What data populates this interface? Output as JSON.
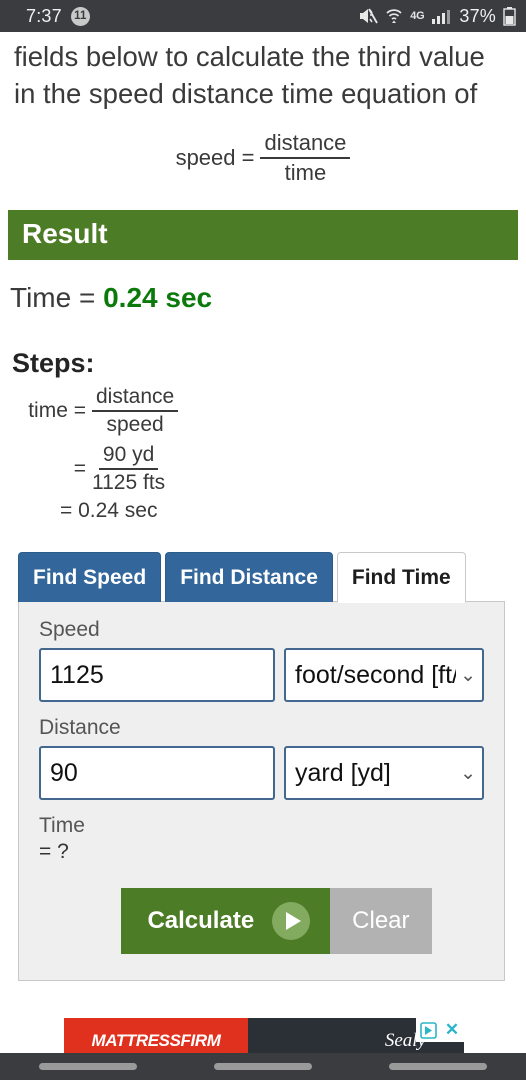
{
  "statusbar": {
    "time": "7:37",
    "notification_count": "11",
    "mute_icon": "mute-icon",
    "wifi_icon": "wifi-icon",
    "network_label": "4G",
    "signal_icon": "signal-bars-icon",
    "battery_percent": "37%",
    "battery_icon": "battery-icon"
  },
  "article": {
    "paragraph": "fields below to calculate the third value in the speed distance time equation of",
    "formula": {
      "lhs": "speed =",
      "numerator": "distance",
      "denominator": "time"
    }
  },
  "result": {
    "heading": "Result",
    "label": "Time = ",
    "value": "0.24 sec",
    "value_color": "#0b7a0b",
    "banner_color": "#4d7c26"
  },
  "steps": {
    "title": "Steps:",
    "line1": {
      "lead": "time =",
      "numerator": "distance",
      "denominator": "speed"
    },
    "line2": {
      "lead": "=",
      "numerator": "90 yd",
      "denominator": "1125 fts"
    },
    "line3": "= 0.24 sec"
  },
  "calculator": {
    "tabs": [
      {
        "label": "Find Speed",
        "active": false
      },
      {
        "label": "Find Distance",
        "active": false
      },
      {
        "label": "Find Time",
        "active": true
      }
    ],
    "tab_color": "#33679b",
    "fields": [
      {
        "label": "Speed",
        "value": "1125",
        "placeholder": "",
        "unit": "foot/second [ft/s]",
        "unit_display": "foot/second [ft/s",
        "chevron": "chevron-down-icon"
      },
      {
        "label": "Distance",
        "value": "90",
        "placeholder": "",
        "unit": "yard [yd]",
        "unit_display": "yard [yd]",
        "chevron": "chevron-down-icon"
      }
    ],
    "output": {
      "label": "Time",
      "value": "= ?"
    },
    "buttons": {
      "calculate": "Calculate",
      "calculate_icon": "play-icon",
      "clear": "Clear"
    }
  },
  "ad": {
    "brand_prefix": "MATTRESS",
    "brand_suffix": "FIRM",
    "secondary_brand": "Sealy",
    "adchoices_icon": "adchoices-icon",
    "close_icon": "close-icon"
  },
  "navbar": {
    "recents": "recents-button",
    "home": "home-button",
    "back": "back-button"
  }
}
